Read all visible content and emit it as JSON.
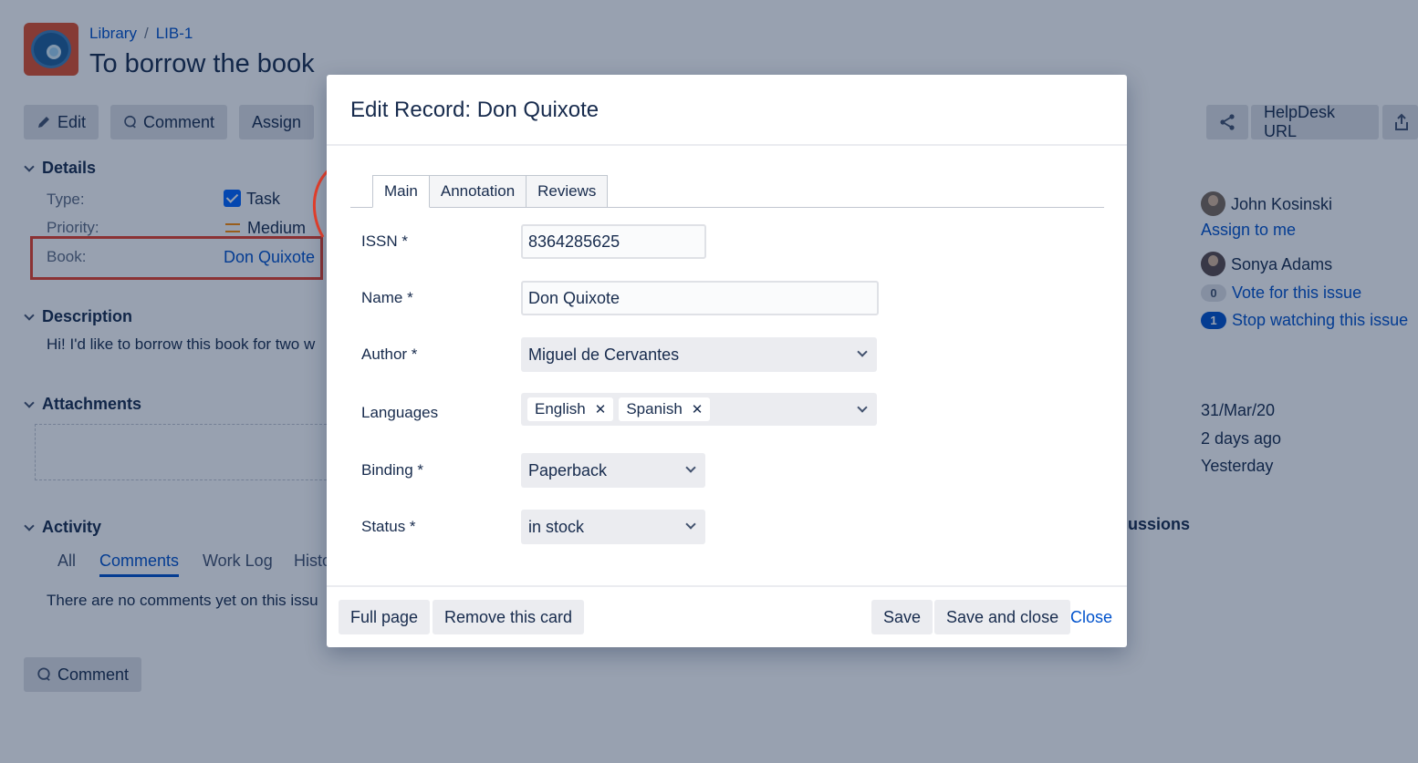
{
  "breadcrumb": {
    "project": "Library",
    "issue_key": "LIB-1"
  },
  "issue": {
    "title": "To borrow the book"
  },
  "toolbar": {
    "edit": "Edit",
    "comment": "Comment",
    "assign": "Assign",
    "helpdesk": "HelpDesk URL"
  },
  "details": {
    "heading": "Details",
    "fields": [
      {
        "label": "Type:",
        "value": "Task"
      },
      {
        "label": "Priority:",
        "value": "Medium"
      },
      {
        "label": "Book:",
        "value": "Don Quixote"
      }
    ]
  },
  "description": {
    "heading": "Description",
    "text": "Hi! I'd like to borrow this book for two w"
  },
  "attachments": {
    "heading": "Attachments"
  },
  "activity": {
    "heading": "Activity",
    "tabs": [
      "All",
      "Comments",
      "Work Log",
      "Histo"
    ],
    "empty_text": "There are no comments yet on this issu",
    "comment_button": "Comment"
  },
  "people": {
    "assignee": "John Kosinski",
    "assign_to_me": "Assign to me",
    "reporter": "Sonya Adams",
    "votes": {
      "count": "0",
      "label": "Vote for this issue"
    },
    "watchers": {
      "count": "1",
      "label": "Stop watching this issue"
    }
  },
  "dates": {
    "created": "31/Mar/20",
    "updated": "2 days ago",
    "resolved": "Yesterday"
  },
  "side_partial": "ussions",
  "dialog": {
    "title": "Edit Record: Don Quixote",
    "tabs": [
      "Main",
      "Annotation",
      "Reviews"
    ],
    "fields": {
      "issn": {
        "label": "ISSN *",
        "value": "8364285625"
      },
      "name": {
        "label": "Name *",
        "value": "Don Quixote"
      },
      "author": {
        "label": "Author *",
        "value": "Miguel de Cervantes"
      },
      "languages": {
        "label": "Languages",
        "tags": [
          "English",
          "Spanish"
        ]
      },
      "binding": {
        "label": "Binding *",
        "value": "Paperback"
      },
      "status": {
        "label": "Status *",
        "value": "in stock"
      }
    },
    "footer": {
      "full_page": "Full page",
      "remove": "Remove this card",
      "save": "Save",
      "save_close": "Save and close",
      "close": "Close"
    }
  },
  "colors": {
    "accent": "#0052cc",
    "annotation": "#e8402a",
    "project_avatar": "#e0502c"
  }
}
